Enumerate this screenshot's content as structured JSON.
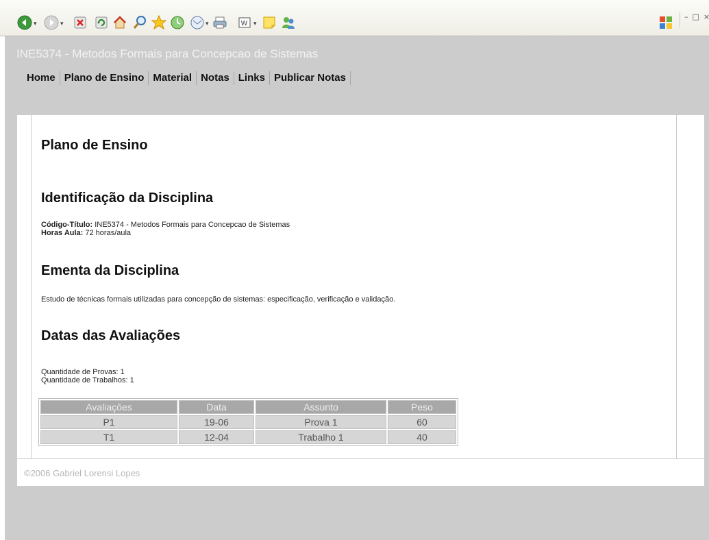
{
  "browser": {
    "toolbar_icons": [
      "back-icon",
      "forward-icon",
      "stop-icon",
      "refresh-icon",
      "home-icon",
      "search-icon",
      "favorites-icon",
      "history-icon",
      "mail-icon",
      "print-icon",
      "edit-word-icon",
      "notes-icon",
      "messenger-icon"
    ],
    "window_controls": [
      "–",
      "□",
      "×"
    ]
  },
  "site": {
    "title": "INE5374 - Metodos Formais para Concepcao de Sistemas",
    "nav": [
      "Home",
      "Plano de Ensino",
      "Material",
      "Notas",
      "Links",
      "Publicar Notas"
    ]
  },
  "content": {
    "page_title": "Plano de Ensino",
    "identificacao": {
      "heading": "Identificação da Disciplina",
      "codigo_label": "Código-Título:",
      "codigo_value": "INE5374 - Metodos Formais para Concepcao de Sistemas",
      "horas_label": "Horas Aula:",
      "horas_value": "72 horas/aula"
    },
    "ementa": {
      "heading": "Ementa da Disciplina",
      "text": "Estudo de técnicas formais utilizadas para concepção de sistemas: especificação, verificação e validação."
    },
    "avaliacoes": {
      "heading": "Datas das Avaliações",
      "provas": "Quantidade de Provas: 1",
      "trabalhos": "Quantidade de Trabalhos: 1",
      "columns": [
        "Avaliações",
        "Data",
        "Assunto",
        "Peso"
      ],
      "rows": [
        [
          "P1",
          "19-06",
          "Prova 1",
          "60"
        ],
        [
          "T1",
          "12-04",
          "Trabalho 1",
          "40"
        ]
      ]
    }
  },
  "footer": {
    "text": "©2006 Gabriel Lorensi Lopes"
  },
  "colors": {
    "page_bg": "#cccccc",
    "content_bg": "#ffffff",
    "table_header": "#a8a8a8",
    "table_cell": "#d6d6d6"
  }
}
